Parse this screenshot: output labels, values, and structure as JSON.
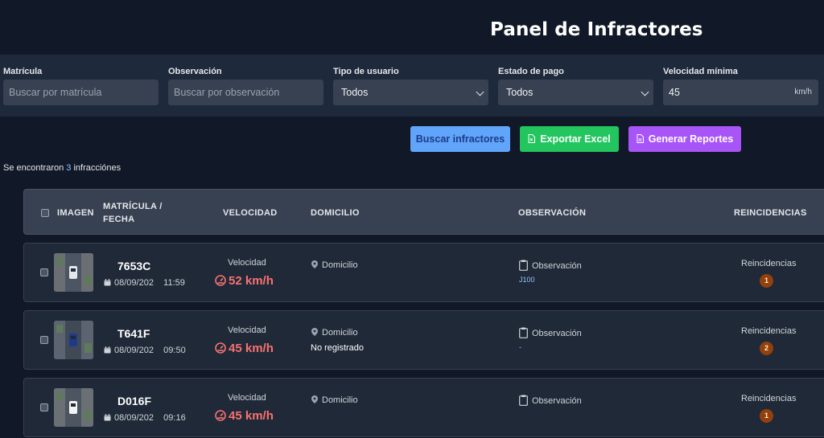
{
  "header": {
    "title": "Panel de Infractores"
  },
  "filters": {
    "plate": {
      "label": "Matrícula",
      "placeholder": "Buscar por matrícula"
    },
    "observation": {
      "label": "Observación",
      "placeholder": "Buscar por observación"
    },
    "user_type": {
      "label": "Tipo de usuario",
      "value": "Todos"
    },
    "payment": {
      "label": "Estado de pago",
      "value": "Todos"
    },
    "min_speed": {
      "label": "Velocidad mínima",
      "value": "45",
      "unit": "km/h"
    }
  },
  "actions": {
    "search": "Buscar infractores",
    "excel": "Exportar Excel",
    "reports": "Generar Reportes"
  },
  "results": {
    "prefix": "Se encontraron ",
    "count": "3",
    "suffix": " infracciónes"
  },
  "table": {
    "headers": {
      "image": "IMAGEN",
      "plate_date_1": "MATRÍCULA /",
      "plate_date_2": "FECHA",
      "speed": "VELOCIDAD",
      "address": "DOMICILIO",
      "observation": "OBSERVACIÓN",
      "recidivism": "REINCIDENCIAS"
    },
    "rows": [
      {
        "plate": "7653C",
        "date": "08/09/202",
        "time": "11:59",
        "speed_label": "Velocidad",
        "speed": "52 km/h",
        "address_label": "Domicilio",
        "address": "",
        "obs_label": "Observación",
        "obs": "J100",
        "reinc_label": "Reincidencias",
        "reinc": "1"
      },
      {
        "plate": "T641F",
        "date": "08/09/202",
        "time": "09:50",
        "speed_label": "Velocidad",
        "speed": "45 km/h",
        "address_label": "Domicilio",
        "address": "No registrado",
        "obs_label": "Observación",
        "obs": "-",
        "reinc_label": "Reincidencias",
        "reinc": "2"
      },
      {
        "plate": "D016F",
        "date": "08/09/202",
        "time": "09:16",
        "speed_label": "Velocidad",
        "speed": "45 km/h",
        "address_label": "Domicilio",
        "address": "",
        "obs_label": "Observación",
        "obs": "",
        "reinc_label": "Reincidencias",
        "reinc": "1"
      }
    ]
  },
  "icons": {
    "calendar": "calendar-icon",
    "speedometer": "speedometer-icon",
    "location": "location-pin-icon",
    "clipboard": "clipboard-icon",
    "spreadsheet": "file-excel-icon",
    "report": "file-report-icon"
  },
  "colors": {
    "search_button": "#60a5fa",
    "excel_button": "#22c55e",
    "report_button": "#a855f7",
    "speed": "#f87171",
    "badge": "#92400e"
  }
}
